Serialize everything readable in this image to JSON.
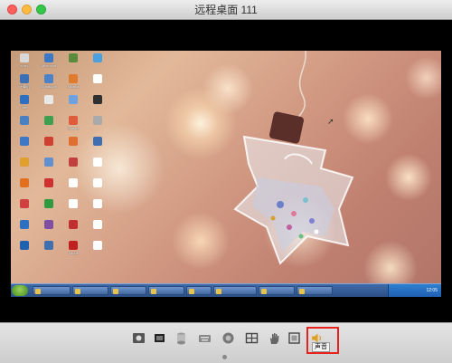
{
  "window": {
    "title": "远程桌面  111"
  },
  "desktop": {
    "icons": [
      {
        "label": "sorry",
        "color": "#d9d9d9"
      },
      {
        "label": "Microsoft",
        "color": "#3c78c8"
      },
      {
        "label": "",
        "color": "#5a8a3c"
      },
      {
        "label": "",
        "color": "#4aa0e0"
      },
      {
        "label": "计算机",
        "color": "#3b6fb6"
      },
      {
        "label": "SignalApp",
        "color": "#4c82c8"
      },
      {
        "label": "Mozilla",
        "color": "#e07a2c"
      },
      {
        "label": "",
        "color": "#ffffff"
      },
      {
        "label": "Inte",
        "color": "#2f6fc0"
      },
      {
        "label": "",
        "color": "#e8e8e8"
      },
      {
        "label": "",
        "color": "#6fa0e0"
      },
      {
        "label": "",
        "color": "#303030"
      },
      {
        "label": "",
        "color": "#4a7fc0"
      },
      {
        "label": "",
        "color": "#3ca050"
      },
      {
        "label": "Google",
        "color": "#e05a3c"
      },
      {
        "label": "",
        "color": "#aaaaaa"
      },
      {
        "label": "",
        "color": "#3d77c5"
      },
      {
        "label": "",
        "color": "#d04030"
      },
      {
        "label": "",
        "color": "#e07030"
      },
      {
        "label": "",
        "color": "#3f6fb0"
      },
      {
        "label": "",
        "color": "#e0a030"
      },
      {
        "label": "",
        "color": "#6090d0"
      },
      {
        "label": "",
        "color": "#c04040"
      },
      {
        "label": "",
        "color": "#ffffff"
      },
      {
        "label": "",
        "color": "#e07020"
      },
      {
        "label": "",
        "color": "#d03030"
      },
      {
        "label": "",
        "color": "#ffffff"
      },
      {
        "label": "",
        "color": "#ffffff"
      },
      {
        "label": "",
        "color": "#d04040"
      },
      {
        "label": "",
        "color": "#2f9a40"
      },
      {
        "label": "",
        "color": "#ffffff"
      },
      {
        "label": "",
        "color": "#ffffff"
      },
      {
        "label": "",
        "color": "#3070c0"
      },
      {
        "label": "",
        "color": "#8050a0"
      },
      {
        "label": "",
        "color": "#c03030"
      },
      {
        "label": "",
        "color": "#ffffff"
      },
      {
        "label": "",
        "color": "#2060b0"
      },
      {
        "label": "",
        "color": "#4070b0"
      },
      {
        "label": "Adobe",
        "color": "#c02020"
      },
      {
        "label": "",
        "color": "#ffffff"
      }
    ],
    "taskbar": {
      "items": [
        "",
        "",
        "",
        "",
        "",
        "",
        "",
        ""
      ],
      "clock": "12:05"
    }
  },
  "toolbar": {
    "buttons": [
      {
        "icon": "settings-icon"
      },
      {
        "icon": "fullscreen-icon"
      },
      {
        "icon": "disk-icon"
      },
      {
        "icon": "keyboard-icon"
      },
      {
        "icon": "record-icon"
      },
      {
        "icon": "split-view-icon"
      },
      {
        "icon": "hand-icon"
      },
      {
        "icon": "fit-screen-icon"
      },
      {
        "icon": "sound-icon"
      }
    ],
    "sound_tooltip": "声音",
    "highlight_color": "#e8231d"
  }
}
